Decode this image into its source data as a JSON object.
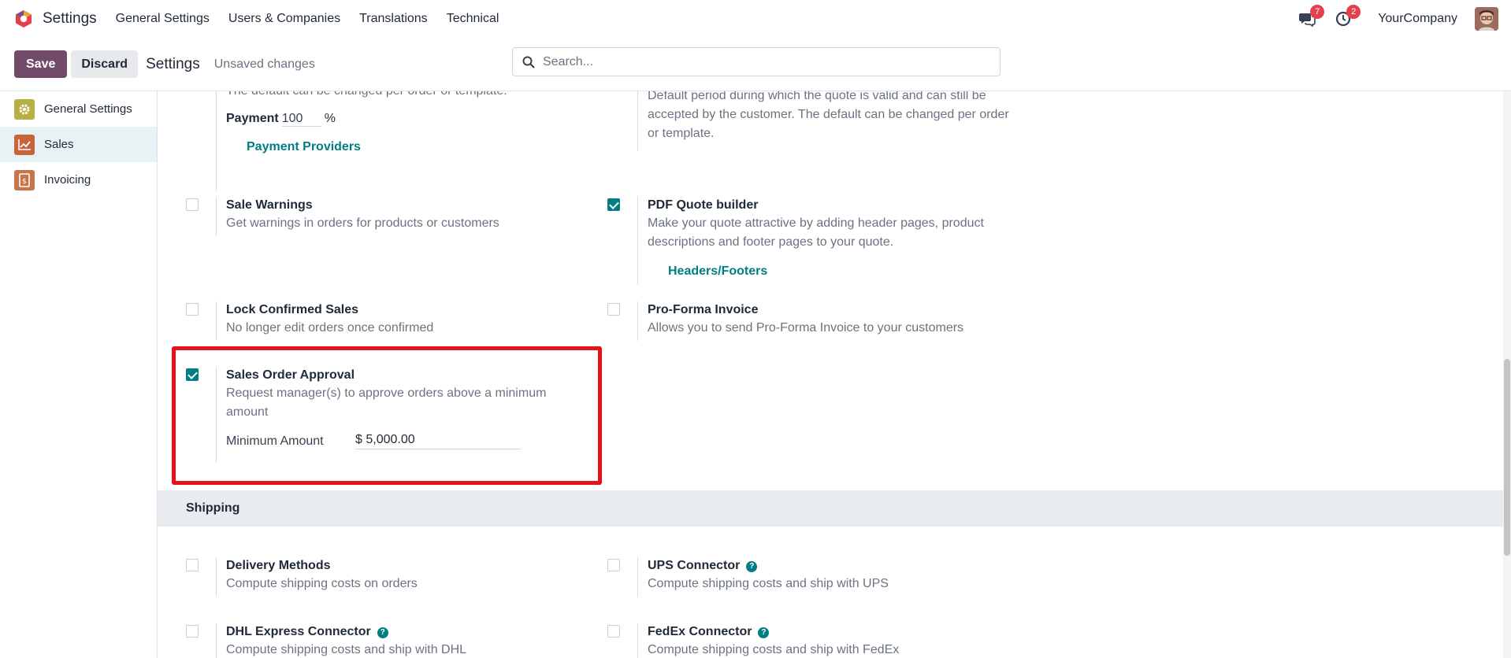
{
  "navbar": {
    "app_name": "Settings",
    "menu": [
      "General Settings",
      "Users & Companies",
      "Translations",
      "Technical"
    ],
    "messages_count": "7",
    "activity_count": "2",
    "company": "YourCompany"
  },
  "control": {
    "save_label": "Save",
    "discard_label": "Discard",
    "breadcrumb": "Settings",
    "status": "Unsaved changes",
    "search_placeholder": "Search..."
  },
  "sidebar": {
    "items": [
      {
        "label": "General Settings",
        "icon": "gear-icon",
        "color": "#b8b045"
      },
      {
        "label": "Sales",
        "icon": "chart-icon",
        "color": "#c9643a"
      },
      {
        "label": "Invoicing",
        "icon": "invoice-icon",
        "color": "#c6764a"
      }
    ]
  },
  "settings": {
    "payment_desc": "The default can be changed per order or template.",
    "payment_label": "Payment",
    "payment_value": "100",
    "payment_unit": "%",
    "payment_providers_link": "Payment Providers",
    "quote_validity_desc": "Default period during which the quote is valid and can still be accepted by the customer. The default can be changed per order or template.",
    "sale_warnings": {
      "title": "Sale Warnings",
      "desc": "Get warnings in orders for products or customers",
      "checked": false
    },
    "pdf_quote": {
      "title": "PDF Quote builder",
      "desc": "Make your quote attractive by adding header pages, product descriptions and footer pages to your quote.",
      "link": "Headers/Footers",
      "checked": true
    },
    "lock_confirmed": {
      "title": "Lock Confirmed Sales",
      "desc": "No longer edit orders once confirmed",
      "checked": false
    },
    "pro_forma": {
      "title": "Pro-Forma Invoice",
      "desc": "Allows you to send Pro-Forma Invoice to your customers",
      "checked": false
    },
    "approval": {
      "title": "Sales Order Approval",
      "desc": "Request manager(s) to approve orders above a minimum amount",
      "min_label": "Minimum Amount",
      "min_value": "$ 5,000.00",
      "checked": true
    }
  },
  "shipping": {
    "heading": "Shipping",
    "delivery": {
      "title": "Delivery Methods",
      "desc": "Compute shipping costs on orders"
    },
    "ups": {
      "title": "UPS Connector",
      "desc": "Compute shipping costs and ship with UPS"
    },
    "dhl": {
      "title": "DHL Express Connector",
      "desc": "Compute shipping costs and ship with DHL"
    },
    "fedex": {
      "title": "FedEx Connector",
      "desc": "Compute shipping costs and ship with FedEx"
    }
  },
  "colors": {
    "brand": "#714b67",
    "accent": "#017e84",
    "highlight": "#e8101a"
  }
}
